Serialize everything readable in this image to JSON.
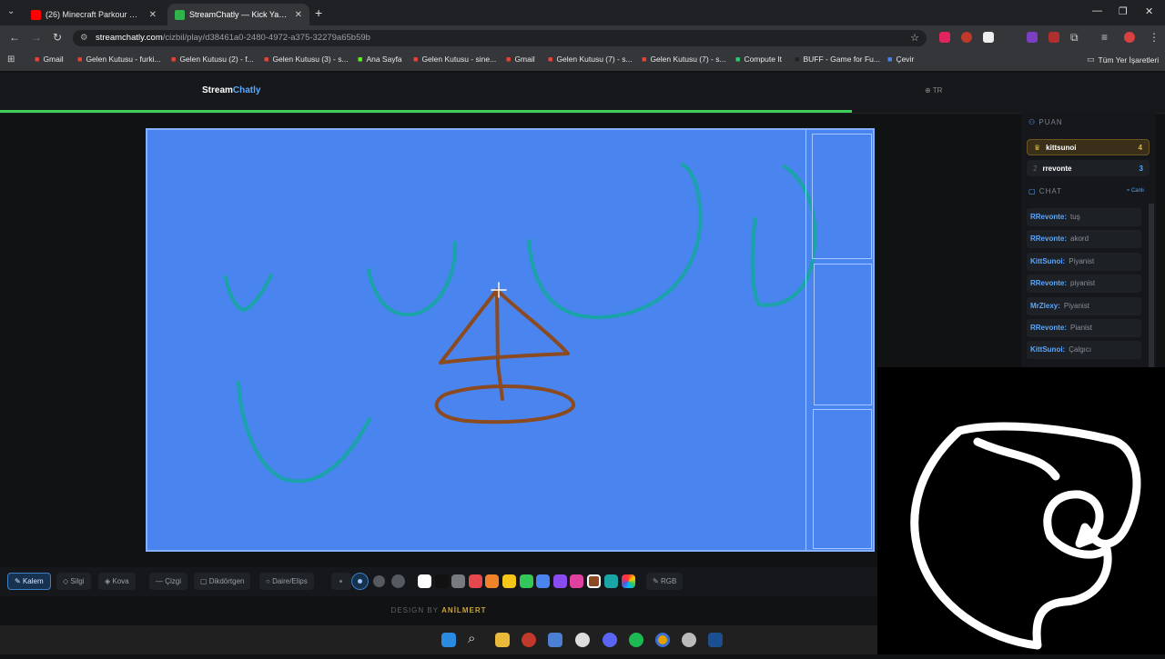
{
  "browser": {
    "tabs": [
      {
        "title": "(26) Minecraft Parkour Gamepla",
        "icon": "youtube-icon"
      },
      {
        "title": "StreamChatly — Kick Yayıncıları",
        "icon": "streamchatly-icon"
      }
    ],
    "new_tab": "+",
    "url_domain": "streamchatly.com",
    "url_path": "/cizbil/play/d38461a0-2480-4972-a375-32279a65b59b",
    "bookmarks": [
      {
        "label": "Gmail",
        "icon": "gmail-icon"
      },
      {
        "label": "Gelen Kutusu - furki...",
        "icon": "gmail-icon"
      },
      {
        "label": "Gelen Kutusu (2) - f...",
        "icon": "gmail-icon"
      },
      {
        "label": "Gelen Kutusu (3) - s...",
        "icon": "gmail-icon"
      },
      {
        "label": "Ana Sayfa",
        "icon": "kick-icon"
      },
      {
        "label": "Gelen Kutusu - sine...",
        "icon": "gmail-icon"
      },
      {
        "label": "Gmail",
        "icon": "gmail-icon"
      },
      {
        "label": "Gelen Kutusu (7) - s...",
        "icon": "gmail-icon"
      },
      {
        "label": "Gelen Kutusu (7) - s...",
        "icon": "gmail-icon"
      },
      {
        "label": "Compute It",
        "icon": "compute-icon"
      },
      {
        "label": "BUFF - Game for Fu...",
        "icon": "buff-icon"
      },
      {
        "label": "Çevir",
        "icon": "translate-icon"
      }
    ],
    "all_bookmarks": "Tüm Yer İşaretleri"
  },
  "site": {
    "logo_part1": "Stream",
    "logo_part2": "Chatly",
    "lang": "TR"
  },
  "scoreboard": {
    "title": "PUAN",
    "players": [
      {
        "rank": "♛",
        "name": "kittsunoi",
        "points": "4"
      },
      {
        "rank": "2",
        "name": "rrevonte",
        "points": "3"
      }
    ]
  },
  "chat": {
    "title": "CHAT",
    "live": "Canlı",
    "messages": [
      {
        "user": "RRevonte:",
        "text": "tuş"
      },
      {
        "user": "RRevonte:",
        "text": "akord"
      },
      {
        "user": "KittSunoi:",
        "text": "Piyanist"
      },
      {
        "user": "RRevonte:",
        "text": "piyanist"
      },
      {
        "user": "MrZlexy:",
        "text": "Piyanist"
      },
      {
        "user": "RRevonte:",
        "text": "Pianist"
      },
      {
        "user": "KittSunoi:",
        "text": "Çalgıcı"
      }
    ]
  },
  "tools": {
    "pen": "Kalem",
    "eraser": "Silgi",
    "bucket": "Kova",
    "line": "Çizgi",
    "rect": "Dikdörtgen",
    "ellipse": "Daire/Elips",
    "rgb": "RGB"
  },
  "palette": [
    "#ffffff",
    "#111111",
    "#777b80",
    "#e5484d",
    "#f0822c",
    "#f5c518",
    "#34c759",
    "#4a84ee",
    "#8a4bf0",
    "#e0409e",
    "#8b4a1f",
    "#1aa6a6"
  ],
  "selected_color": "#8b4a1f",
  "footer": {
    "prefix": "DESIGN BY",
    "author": "ANİLMERT"
  },
  "colors": {
    "canvas": "#4a84ee",
    "teal_stroke": "#1aa3a8",
    "brown_stroke": "#8b4a1f",
    "accent": "#5aa8ff",
    "progress": "#3fcf5a"
  }
}
